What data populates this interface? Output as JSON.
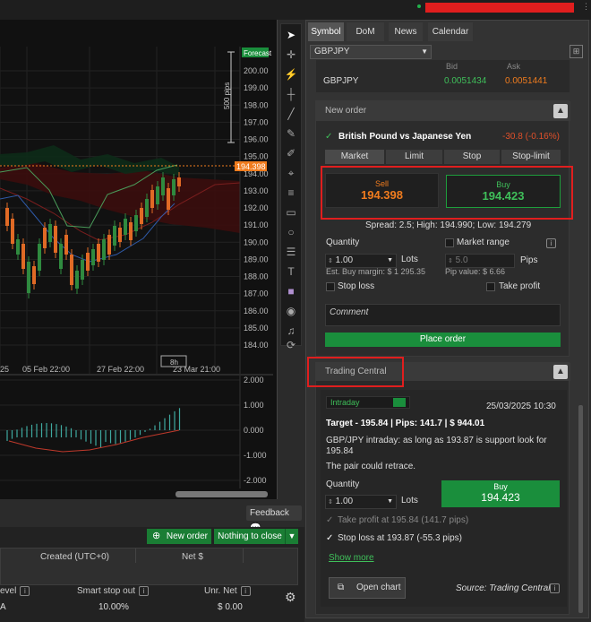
{
  "colors": {
    "accent_green": "#1a8e3c",
    "price_orange": "#f07c1e",
    "red_highlight": "#e01e1e",
    "bid_green": "#3fbf5a",
    "ask_orange": "#f07c1e"
  },
  "chart": {
    "price_ticks": [
      "200.00",
      "199.00",
      "198.00",
      "197.00",
      "196.00",
      "195.00",
      "194.00",
      "193.00",
      "192.00",
      "191.00",
      "190.00",
      "189.00",
      "188.00",
      "187.00",
      "186.00",
      "185.00",
      "184.00"
    ],
    "current_price_tag": "194.398",
    "top_tag": "Forecast",
    "pips_label": "500 pips",
    "date_labels": [
      "25",
      "05 Feb 22:00",
      "27 Feb 22:00",
      "23 Mar 21:00"
    ],
    "time_marker": "8h",
    "osc_ticks": [
      "2.000",
      "1.000",
      "0.000",
      "-1.000",
      "-2.000"
    ]
  },
  "bottom": {
    "feedback": "Feedback",
    "new_order": "New order",
    "nothing_to_close": "Nothing to close",
    "col_created": "Created (UTC+0)",
    "col_net": "Net $",
    "col_level": "evel",
    "col_smart_stop": "Smart stop out",
    "col_unr_net": "Unr. Net",
    "row_a": "A",
    "row_smart_stop_val": "10.00%",
    "row_unr_net_val": "$ 0.00"
  },
  "right": {
    "tabs": [
      "Symbol",
      "DoM",
      "News",
      "Calendar"
    ],
    "symbol_select": "GBPJPY",
    "quote": {
      "bid_label": "Bid",
      "ask_label": "Ask",
      "symbol": "GBPJPY",
      "bid": "0.0051434",
      "ask": "0.0051441"
    },
    "new_order": {
      "header": "New order",
      "instrument": "British Pound vs Japanese Yen",
      "change": "-30.8 (-0.16%)",
      "order_tabs": [
        "Market",
        "Limit",
        "Stop",
        "Stop-limit"
      ],
      "sell_label": "Sell",
      "sell_price": "194.398",
      "buy_label": "Buy",
      "buy_price": "194.423",
      "spread": "Spread: 2.5; High: 194.990; Low: 194.279",
      "quantity_label": "Quantity",
      "market_range_label": "Market range",
      "quantity_value": "1.00",
      "lots_label": "Lots",
      "range_value": "5.0",
      "pips_label": "Pips",
      "margin": "Est. Buy margin: $ 1 295.35",
      "pip_value": "Pip value: $ 6.66",
      "stop_loss": "Stop loss",
      "take_profit": "Take profit",
      "comment_placeholder": "Comment",
      "place_order": "Place order"
    },
    "tc": {
      "header": "Trading Central",
      "timeframe": "Intraday",
      "datetime": "25/03/2025 10:30",
      "target_line": "Target  -  195.84  |  Pips: 141.7  |  $ 944.01",
      "desc": "GBP/JPY intraday: as long as 193.87 is support look for 195.84",
      "retrace": "The pair could retrace.",
      "quantity_label": "Quantity",
      "quantity_value": "1.00",
      "lots_label": "Lots",
      "buy_label": "Buy",
      "buy_price": "194.423",
      "take_profit": "Take profit at 195.84  (141.7 pips)",
      "stop_loss": "Stop loss at 193.87  (-55.3 pips)",
      "show_more": "Show more",
      "open_chart": "Open chart",
      "source": "Source: Trading Central"
    }
  }
}
